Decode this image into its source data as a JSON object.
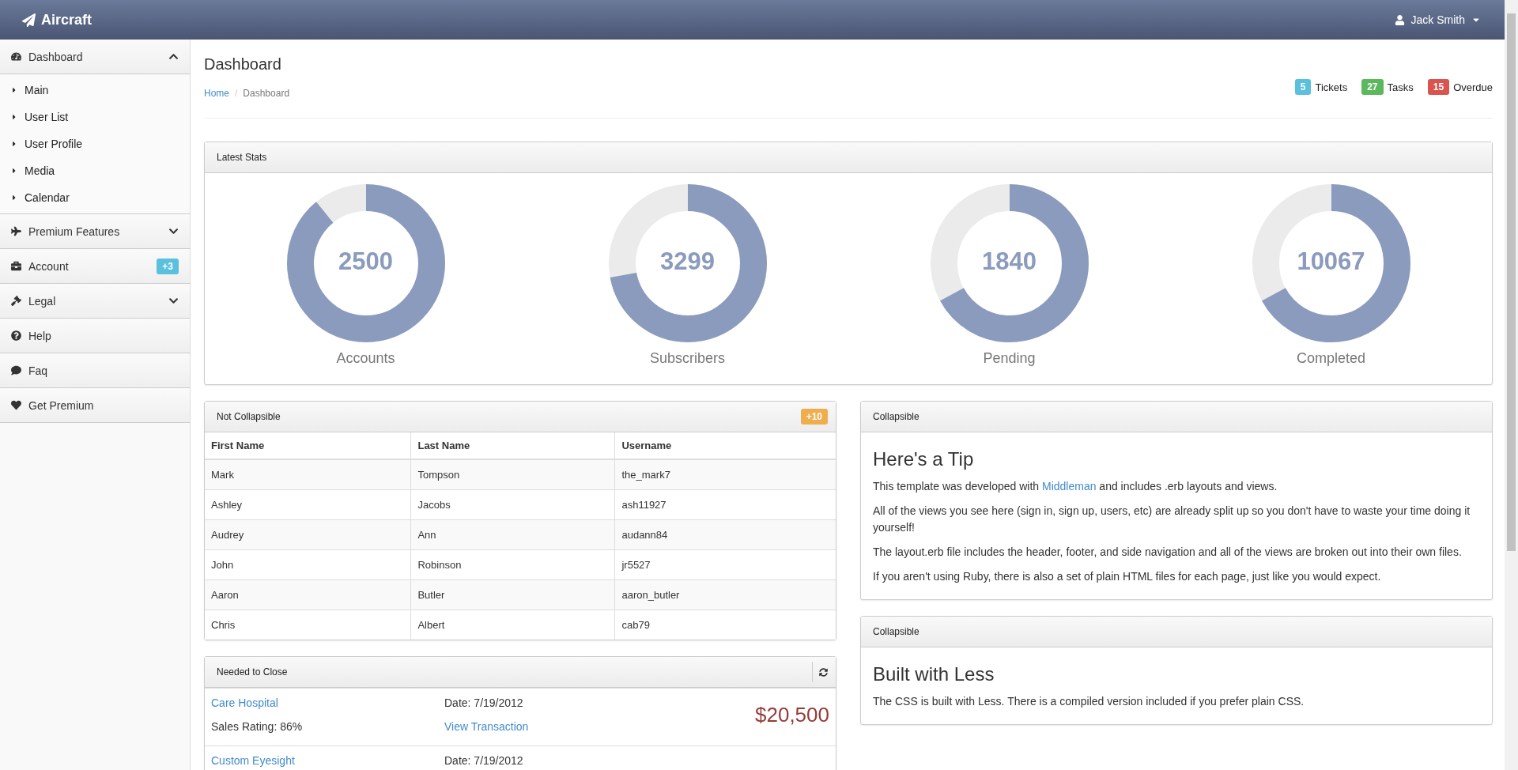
{
  "brand": "Aircraft",
  "user": {
    "name": "Jack Smith"
  },
  "sidebar": {
    "items": [
      {
        "label": "Dashboard",
        "kind": "group",
        "expanded": true,
        "children": [
          {
            "label": "Main"
          },
          {
            "label": "User List"
          },
          {
            "label": "User Profile"
          },
          {
            "label": "Media"
          },
          {
            "label": "Calendar"
          }
        ]
      },
      {
        "label": "Premium Features",
        "kind": "group",
        "expanded": false
      },
      {
        "label": "Account",
        "kind": "badge",
        "badge": "+3"
      },
      {
        "label": "Legal",
        "kind": "group",
        "expanded": false
      },
      {
        "label": "Help",
        "kind": "link"
      },
      {
        "label": "Faq",
        "kind": "link"
      },
      {
        "label": "Get Premium",
        "kind": "link"
      }
    ]
  },
  "page": {
    "title": "Dashboard",
    "separator": "/",
    "breadcrumb": [
      {
        "label": "Home",
        "selected": false
      },
      {
        "label": "Dashboard",
        "selected": true
      }
    ]
  },
  "counters": [
    {
      "count": "5",
      "label": "Tickets",
      "color": "#5bc0de"
    },
    {
      "count": "27",
      "label": "Tasks",
      "color": "#5cb85c"
    },
    {
      "count": "15",
      "label": "Overdue",
      "color": "#d9534f"
    }
  ],
  "stats": {
    "title": "Latest Stats",
    "items": [
      {
        "value": "2500",
        "label": "Accounts",
        "level": 0.89
      },
      {
        "value": "3299",
        "label": "Subscribers",
        "level": 0.72
      },
      {
        "value": "1840",
        "label": "Pending",
        "level": 0.67
      },
      {
        "value": "10067",
        "label": "Completed",
        "level": 0.67
      }
    ]
  },
  "users_panel": {
    "title": "Not Collapsible",
    "badge": "+10",
    "columns": [
      "First Name",
      "Last Name",
      "Username"
    ],
    "rows": [
      [
        "Mark",
        "Tompson",
        "the_mark7"
      ],
      [
        "Ashley",
        "Jacobs",
        "ash11927"
      ],
      [
        "Audrey",
        "Ann",
        "audann84"
      ],
      [
        "John",
        "Robinson",
        "jr5527"
      ],
      [
        "Aaron",
        "Butler",
        "aaron_butler"
      ],
      [
        "Chris",
        "Albert",
        "cab79"
      ]
    ]
  },
  "tip_panel": {
    "title": "Collapsible",
    "heading": "Here's a Tip",
    "paragraphs": [
      {
        "text": "This template was developed with ",
        "link": "Middleman",
        "after": " and includes .erb layouts and views."
      },
      {
        "text": "All of the views you see here (sign in, sign up, users, etc) are already split up so you don't have to waste your time doing it yourself!"
      },
      {
        "text": "The layout.erb file includes the header, footer, and side navigation and all of the views are broken out into their own files."
      },
      {
        "text": "If you aren't using Ruby, there is also a set of plain HTML files for each page, just like you would expect."
      }
    ]
  },
  "deals_panel": {
    "title": "Needed to Close",
    "items": [
      {
        "name": "Care Hospital",
        "date": "Date: 7/19/2012",
        "rating": "Sales Rating: 86%",
        "action": "View Transaction",
        "amount": "$20,500"
      },
      {
        "name": "Custom Eyesight",
        "date": "Date: 7/19/2012"
      }
    ]
  },
  "less_panel": {
    "title": "Collapsible",
    "heading": "Built with Less",
    "paragraphs": [
      {
        "text": "The CSS is built with Less. There is a compiled version included if you prefer plain CSS."
      }
    ]
  }
}
